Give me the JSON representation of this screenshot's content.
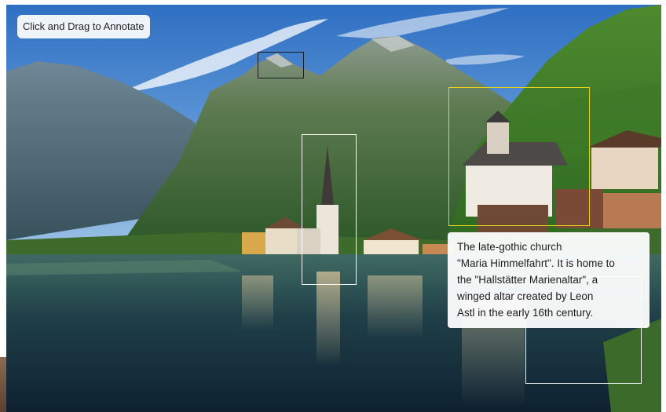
{
  "toolbar": {
    "hint_label": "Click and Drag to Annotate"
  },
  "photo": {
    "subject": "lakeside-alpine-village-photo"
  },
  "annotations": [
    {
      "id": "mountain-peak",
      "style": "dark"
    },
    {
      "id": "church-spire",
      "style": "white"
    },
    {
      "id": "gothic-church",
      "style": "active"
    },
    {
      "id": "boathouse",
      "style": "white"
    }
  ],
  "active_note": {
    "lines": [
      "The late-gothic church",
      "\"Maria Himmelfahrt\". It is home to",
      "the \"Hallstätter Marienaltar\", a",
      "winged altar created by Leon",
      "Astl in the early 16th century."
    ]
  },
  "colors": {
    "active_box": "#e6d21e",
    "inactive_box": "#ffffff",
    "peak_box": "#1b1b1b",
    "note_bg": "#ffffff"
  }
}
